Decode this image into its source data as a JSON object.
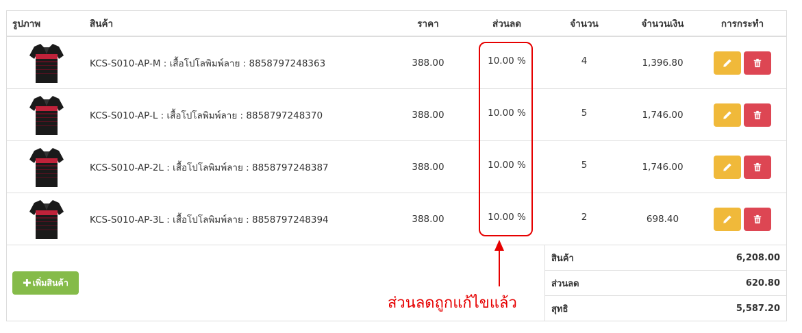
{
  "table": {
    "headers": {
      "image": "รูปภาพ",
      "product": "สินค้า",
      "price": "ราคา",
      "discount": "ส่วนลด",
      "quantity": "จำนวน",
      "amount": "จำนวนเงิน",
      "actions": "การกระทำ"
    },
    "rows": [
      {
        "product": "KCS-S010-AP-M : เสื้อโปโลพิมพ์ลาย : 8858797248363",
        "price": "388.00",
        "discount": "10.00 %",
        "quantity": "4",
        "amount": "1,396.80"
      },
      {
        "product": "KCS-S010-AP-L : เสื้อโปโลพิมพ์ลาย : 8858797248370",
        "price": "388.00",
        "discount": "10.00 %",
        "quantity": "5",
        "amount": "1,746.00"
      },
      {
        "product": "KCS-S010-AP-2L : เสื้อโปโลพิมพ์ลาย : 8858797248387",
        "price": "388.00",
        "discount": "10.00 %",
        "quantity": "5",
        "amount": "1,746.00"
      },
      {
        "product": "KCS-S010-AP-3L : เสื้อโปโลพิมพ์ลาย : 8858797248394",
        "price": "388.00",
        "discount": "10.00 %",
        "quantity": "2",
        "amount": "698.40"
      }
    ]
  },
  "add_button_label": "เพิ่มสินค้า",
  "summary": {
    "products_label": "สินค้า",
    "products_value": "6,208.00",
    "discount_label": "ส่วนลด",
    "discount_value": "620.80",
    "net_label": "สุทธิ",
    "net_value": "5,587.20"
  },
  "annotation": "ส่วนลดถูกแก้ไขแล้ว",
  "icons": {
    "edit": "pencil-icon",
    "delete": "trash-icon",
    "add": "plus-icon",
    "product_image": "polo-shirt-image"
  },
  "colors": {
    "edit_button": "#f0b93a",
    "delete_button": "#dd4653",
    "add_button": "#85bb49",
    "annotation": "#e60000",
    "border": "#dddddd"
  }
}
